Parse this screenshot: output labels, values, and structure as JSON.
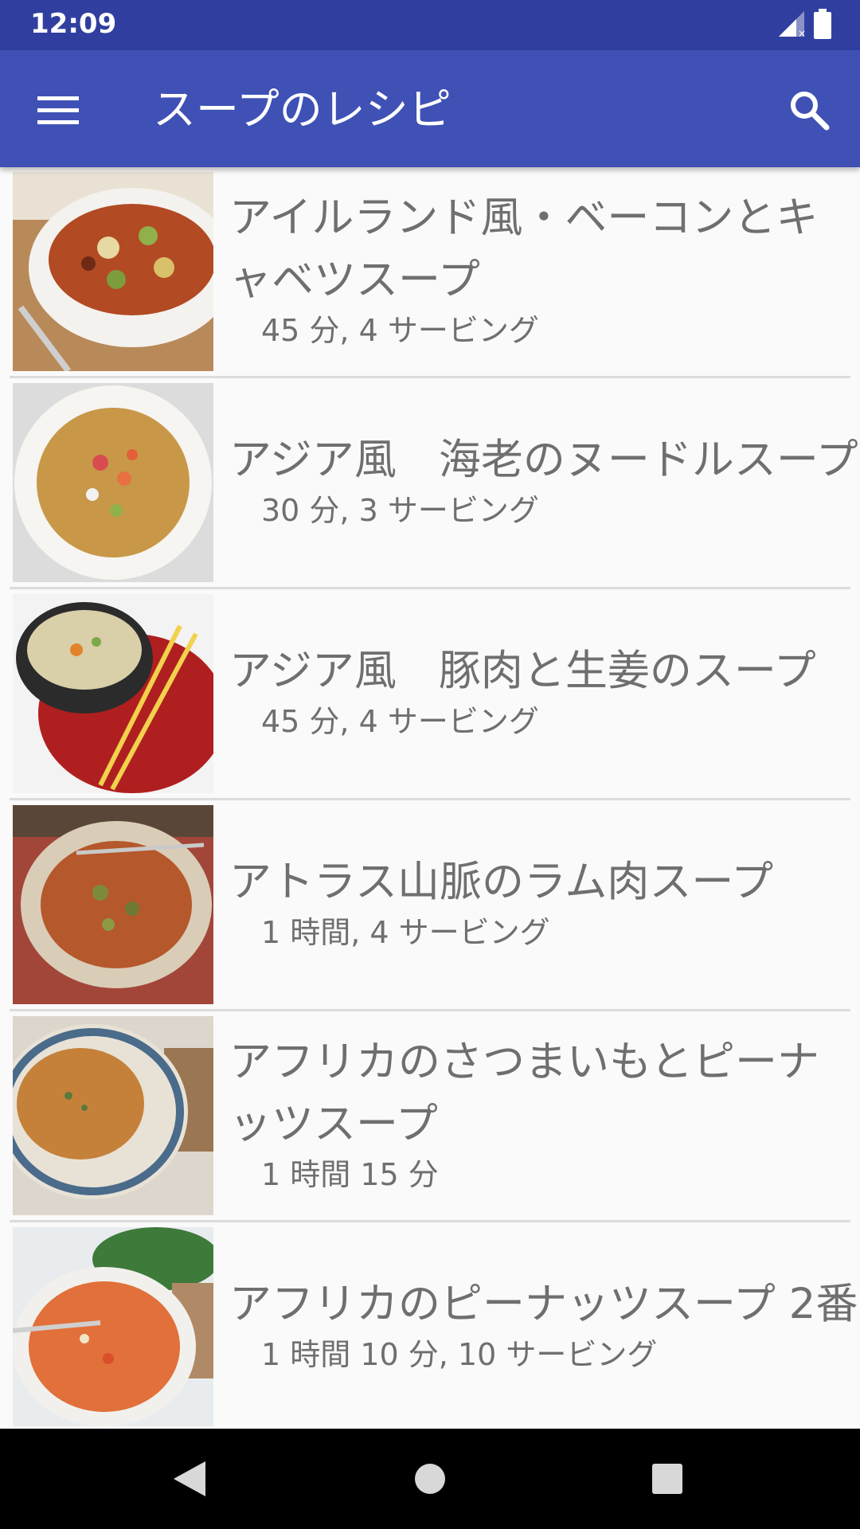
{
  "status_bar": {
    "time": "12:09",
    "icons": [
      "signal-icon",
      "battery-icon"
    ]
  },
  "app_bar": {
    "title": "スープのレシピ",
    "icons": [
      "menu-icon",
      "search-icon"
    ],
    "color": "#3f51b5"
  },
  "recipes": [
    {
      "title": "アイルランド風・ベーコンとキャベツスープ",
      "meta": "45 分, 4 サービング"
    },
    {
      "title": "アジア風　海老のヌードルスープ",
      "meta": "30 分, 3 サービング"
    },
    {
      "title": "アジア風　豚肉と生姜のスープ",
      "meta": "45 分, 4 サービング"
    },
    {
      "title": "アトラス山脈のラム肉スープ",
      "meta": "1 時間, 4 サービング"
    },
    {
      "title": "アフリカのさつまいもとピーナッツスープ",
      "meta": "1 時間 15 分"
    },
    {
      "title": "アフリカのピーナッツスープ 2番",
      "meta": "1 時間 10 分, 10 サービング"
    }
  ],
  "nav_bar": {
    "icons": [
      "back-icon",
      "home-icon",
      "recents-icon"
    ]
  }
}
